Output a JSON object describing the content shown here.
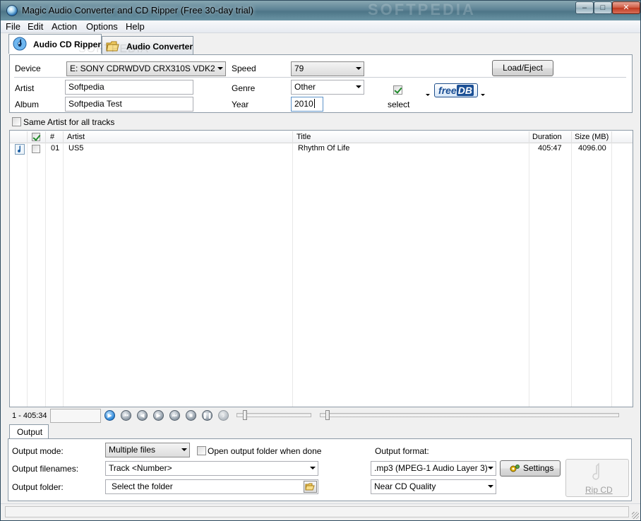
{
  "window": {
    "title": "Magic Audio Converter and CD Ripper (Free 30-day trial)",
    "watermark": "SOFTPEDIA",
    "controls": {
      "minimize": "–",
      "maximize": "□",
      "close": "✕"
    }
  },
  "menu": [
    "File",
    "Edit",
    "Action",
    "Options",
    "Help"
  ],
  "tabs": [
    {
      "label": "Audio CD Ripper",
      "icon": "music-cd-icon",
      "active": true
    },
    {
      "label": "Audio Converter",
      "icon": "folder-convert-icon",
      "active": false
    }
  ],
  "tab_watermark": "SOFTPEDIA",
  "cd_info": {
    "device_label": "Device",
    "device_value": "E: SONY CDRWDVD CRX310S VDK2",
    "speed_label": "Speed",
    "speed_value": "79",
    "load_eject": "Load/Eject",
    "artist_label": "Artist",
    "artist_value": "Softpedia",
    "genre_label": "Genre",
    "genre_value": "Other",
    "album_label": "Album",
    "album_value": "Softpedia Test",
    "year_label": "Year",
    "year_value": "2010",
    "select_label": "select",
    "select_checked": true,
    "freedb_free": "free",
    "freedb_db": "DB"
  },
  "same_artist_label": "Same Artist for all tracks",
  "tracks": {
    "columns": [
      "#",
      "Artist",
      "Title",
      "Duration",
      "Size (MB)"
    ],
    "rows": [
      {
        "number": "01",
        "artist": "US5",
        "title": "Rhythm Of Life",
        "duration": "405:47",
        "size": "4096.00",
        "checked": false
      }
    ]
  },
  "player": {
    "position": "1 - 405:34",
    "buttons": [
      "play",
      "previous",
      "rewind",
      "forward",
      "next",
      "stop",
      "pause",
      "volume"
    ],
    "seek_progress": 0.02
  },
  "output": {
    "tab_label": "Output",
    "mode_label": "Output mode:",
    "mode_value": "Multiple files",
    "open_folder_label": "Open output folder when done",
    "open_folder_checked": false,
    "filenames_label": "Output filenames:",
    "filenames_value": "Track <Number>",
    "folder_label": "Output folder:",
    "folder_value": "Select the folder",
    "format_label": "Output format:",
    "format_value": ".mp3 (MPEG-1 Audio Layer 3)",
    "quality_value": "Near CD Quality",
    "settings_label": "Settings",
    "rip_label": "Rip CD"
  }
}
